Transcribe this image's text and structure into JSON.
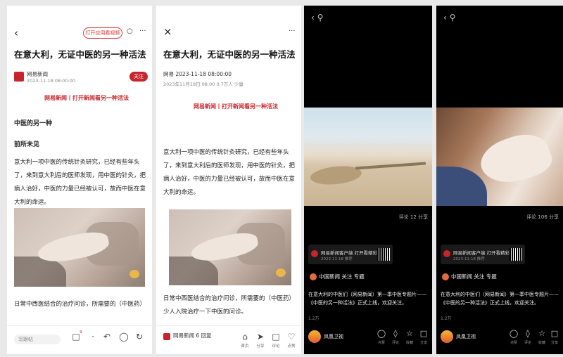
{
  "panel1": {
    "pill": "打开应用看视频",
    "title": "在意大利，无证中医的另一种活法",
    "source": "网易新闻",
    "date": "2023-11-18 08:00:00",
    "follow": "关注",
    "banner": "网易新闻丨打开新闻看另一种活法",
    "section1": "中医的另一种",
    "section2": "前所未见",
    "para": "意大利一项中医的传统针灸研究，已经有些年头了，来到意大利后的医师发现，用中医的针灸，把病人治好，中医的力量已经被认可，故而中医在意大利的命运。",
    "para2": "日常中西医结合的治疗问诊，所需要的（中医药）",
    "input": "写跟帖",
    "icons": [
      {
        "icon": "comment-icon",
        "label": "9"
      },
      {
        "icon": "share-icon",
        "label": ""
      },
      {
        "icon": "like-icon",
        "label": ""
      },
      {
        "icon": "star-icon",
        "label": ""
      },
      {
        "icon": "refresh-icon",
        "label": ""
      }
    ]
  },
  "panel2": {
    "title": "在意大利，无证中医的另一种活法",
    "meta": "网易 2023-11-18 08:00:00",
    "meta2": "2023年11月18日 08:00  0.7万人 少量",
    "banner": "网易新闻丨打开新闻看另一种活法",
    "para": "意大利一项中医的传统针灸研究，已经有些年头了，来到意大利后的医师发现，用中医的针灸，把病人治好，中医的力量已经被认可，故而中医在意大利的命运。",
    "para2": "日常中西医结合的治疗问诊，所需要的（中医药）少人入院治疗一下中医的问诊。",
    "footer_name": "网易新闻 6 回复",
    "icons": [
      {
        "icon": "home-icon",
        "label": "首页"
      },
      {
        "icon": "share-icon",
        "label": "分享"
      },
      {
        "icon": "comment-icon",
        "label": "评论"
      },
      {
        "icon": "like-icon",
        "label": "点赞"
      }
    ]
  },
  "panel3": {
    "meta": "评论 12  分享",
    "ad_title": "网易新闻客户端 打开看精彩",
    "ad_sub": "2023-11-18 推荐",
    "uploader": "中国新闻 关注 专题",
    "caption": "在意大利的中医们（网易新闻）第一季中医专题片——《中医的另一种活法》正式上线，欢迎关注。",
    "cap_sub": "1.2万",
    "channel": "凤凰卫视",
    "actions": [
      {
        "icon": "like-icon",
        "label": "点赞"
      },
      {
        "icon": "comment-icon",
        "label": "评论"
      },
      {
        "icon": "star-icon",
        "label": "收藏"
      },
      {
        "icon": "share-icon",
        "label": "分享"
      }
    ]
  },
  "panel4": {
    "meta": "评论 106  分享",
    "ad_title": "网易新闻客户端 打开看精彩",
    "ad_sub": "2023-11-18 推荐",
    "uploader": "中国新闻 关注 专题",
    "caption": "在意大利的中医们（网易新闻）第一季中医专题片——《中医的另一种活法》正式上线，欢迎关注。",
    "cap_sub": "1.2万",
    "channel": "凤凰卫视",
    "actions": [
      {
        "icon": "like-icon",
        "label": "点赞"
      },
      {
        "icon": "comment-icon",
        "label": "评论"
      },
      {
        "icon": "star-icon",
        "label": "收藏"
      },
      {
        "icon": "share-icon",
        "label": "分享"
      }
    ]
  }
}
